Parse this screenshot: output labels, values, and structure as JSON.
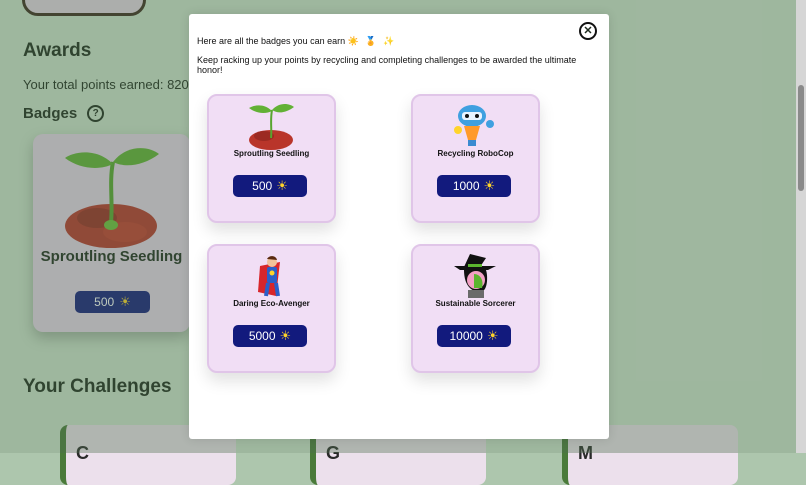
{
  "background": {
    "awards_title": "Awards",
    "points_text": "Your total points earned: 820",
    "badges_title": "Badges",
    "help_symbol": "?",
    "big_card": {
      "name": "Sproutling Seedling",
      "points": "500"
    },
    "challenges_title": "Your Challenges",
    "challenge_titles": [
      "C",
      "G",
      "M"
    ]
  },
  "modal": {
    "intro": "Here are all the badges you can earn",
    "intro_icons": "☀️ 🏅 ✨",
    "description": "Keep racking up your points by recycling and completing challenges to be awarded the ultimate honor!",
    "close_symbol": "✕",
    "badges": [
      {
        "name": "Sproutling Seedling",
        "points": "500",
        "icon": "seedling-icon"
      },
      {
        "name": "Recycling RoboCop",
        "points": "1000",
        "icon": "robot-icon"
      },
      {
        "name": "Daring Eco-Avenger",
        "points": "5000",
        "icon": "superhero-icon"
      },
      {
        "name": "Sustainable Sorcerer",
        "points": "10000",
        "icon": "witch-icon"
      }
    ]
  },
  "sun_symbol": "☀",
  "colors": {
    "accent": "#121a7d",
    "card": "#f1def5",
    "backdrop": "#adc6ad"
  }
}
